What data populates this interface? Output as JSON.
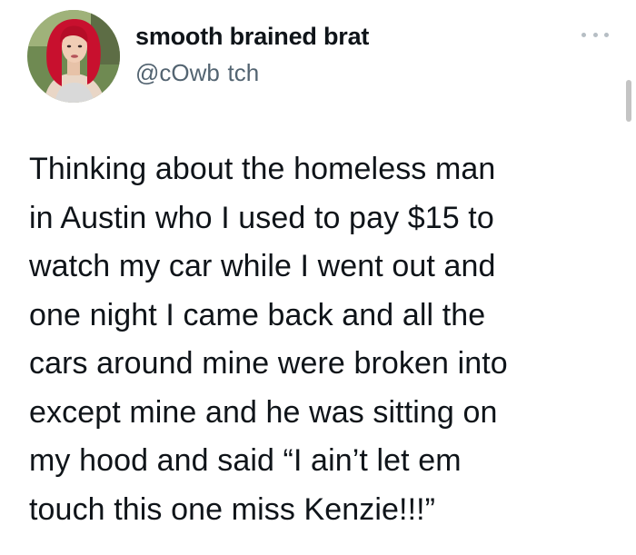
{
  "author": {
    "display_name": "smooth brained brat",
    "handle": "@cOwb    tch"
  },
  "menu": {
    "more_icon": "more-horizontal-icon"
  },
  "tweet": {
    "lines": [
      "Thinking about the homeless man",
      "in Austin who I used to pay $15 to",
      "watch my car while I went out and",
      "one night I came back and all the",
      "cars around mine were broken into",
      "except mine and he was sitting on",
      "my hood and said “I ain’t let em",
      "touch this one miss Kenzie!!!”"
    ]
  },
  "colors": {
    "text": "#0f1419",
    "secondary": "#536471",
    "hair": "#c8102e"
  }
}
